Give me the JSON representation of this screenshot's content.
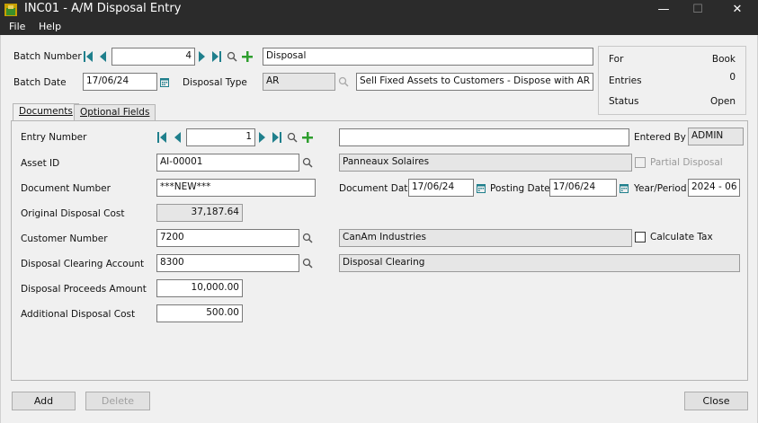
{
  "window": {
    "title": "INC01 - A/M Disposal Entry",
    "minimize": "—",
    "maximize": "☐",
    "close": "✕"
  },
  "menu": {
    "file": "File",
    "help": "Help"
  },
  "batch": {
    "number_label": "Batch Number",
    "number": "4",
    "description": "Disposal",
    "date_label": "Batch Date",
    "date": "17/06/24",
    "type_label": "Disposal Type",
    "type_code": "AR",
    "type_desc": "Sell Fixed Assets to Customers - Dispose with AR Invoice"
  },
  "info": {
    "for_label": "For",
    "for_value": "Book",
    "entries_label": "Entries",
    "entries_value": "0",
    "status_label": "Status",
    "status_value": "Open"
  },
  "tabs": {
    "documents": "Documents",
    "optional_fields": "Optional Fields"
  },
  "doc": {
    "entry_number_label": "Entry Number",
    "entry_number": "1",
    "entry_desc": "",
    "entered_by_label": "Entered By",
    "entered_by": "ADMIN",
    "asset_id_label": "Asset ID",
    "asset_id": "AI-00001",
    "asset_desc": "Panneaux Solaires",
    "partial_disposal_label": "Partial Disposal",
    "document_number_label": "Document Number",
    "document_number": "***NEW***",
    "document_date_label": "Document Date",
    "document_date": "17/06/24",
    "posting_date_label": "Posting Date",
    "posting_date": "17/06/24",
    "year_period_label": "Year/Period",
    "year_period": "2024 - 06",
    "original_cost_label": "Original Disposal Cost",
    "original_cost": "37,187.64",
    "customer_number_label": "Customer Number",
    "customer_number": "7200",
    "customer_name": "CanAm Industries",
    "calculate_tax_label": "Calculate Tax",
    "clearing_account_label": "Disposal Clearing Account",
    "clearing_account": "8300",
    "clearing_desc": "Disposal Clearing",
    "proceeds_label": "Disposal Proceeds Amount",
    "proceeds": "10,000.00",
    "additional_cost_label": "Additional Disposal Cost",
    "additional_cost": "500.00"
  },
  "buttons": {
    "add": "Add",
    "delete": "Delete",
    "close": "Close"
  },
  "colors": {
    "nav_teal": "#1f7f8c",
    "plus_green": "#2e9e2e",
    "titlebar": "#2b2b2b"
  }
}
